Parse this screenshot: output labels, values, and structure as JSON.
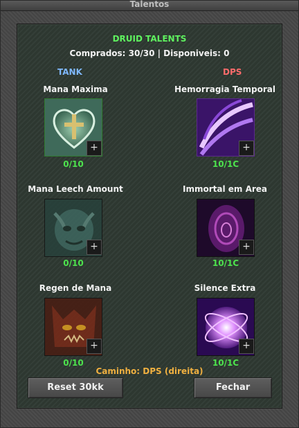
{
  "window": {
    "title": "Talentos"
  },
  "header": {
    "title": "DRUID TALENTS",
    "summary": "Comprados: 30/30 | Disponiveis: 0"
  },
  "columns": {
    "tank_label": "TANK",
    "dps_label": "DPS"
  },
  "talents": {
    "tank": [
      {
        "name": "Mana Maxima",
        "count": "0/10",
        "icon": "heart-cross-icon"
      },
      {
        "name": "Mana Leech Amount",
        "count": "0/10",
        "icon": "demon-mask-icon"
      },
      {
        "name": "Regen de Mana",
        "count": "0/10",
        "icon": "demon-face-icon"
      }
    ],
    "dps": [
      {
        "name": "Hemorragia Temporal",
        "count": "10/1C",
        "icon": "purple-slash-icon"
      },
      {
        "name": "Immortal em Area",
        "count": "10/1C",
        "icon": "purple-vortex-icon"
      },
      {
        "name": "Silence Extra",
        "count": "10/1C",
        "icon": "purple-orb-icon"
      }
    ]
  },
  "footer": {
    "path_label": "Caminho: DPS (direita)",
    "reset_label": "Reset 30kk",
    "close_label": "Fechar"
  },
  "colors": {
    "heading": "#5ff25f",
    "tank": "#7fb8ff",
    "dps": "#ff6b6b",
    "count": "#4de34d",
    "path": "#f0b040"
  }
}
